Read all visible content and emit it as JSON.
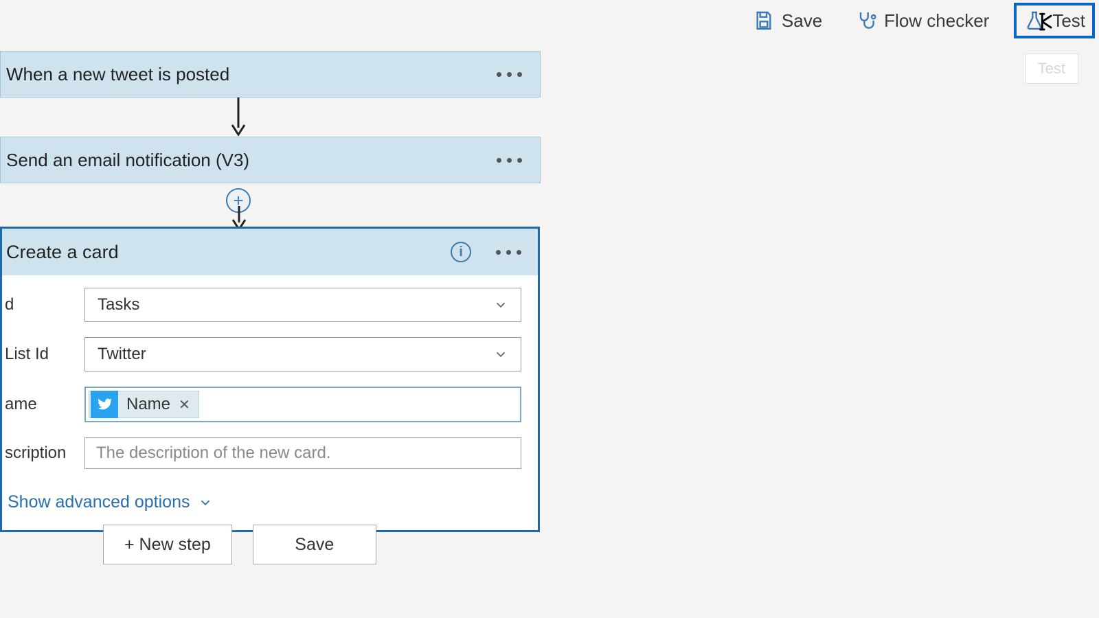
{
  "commandbar": {
    "save": "Save",
    "flow_checker": "Flow checker",
    "test": "Test",
    "test_tooltip": "Test"
  },
  "flow": {
    "trigger_title": "When a new tweet is posted",
    "action1_title": "Send an email notification (V3)",
    "action2_title": "Create a card"
  },
  "card_fields": {
    "board_label": "d",
    "board_value": "Tasks",
    "list_label": "List Id",
    "list_value": "Twitter",
    "name_label": "ame",
    "name_token": "Name",
    "desc_label": "scription",
    "desc_placeholder": "The description of the new card.",
    "advanced": "Show advanced options"
  },
  "footer": {
    "new_step": "+ New step",
    "save": "Save"
  }
}
